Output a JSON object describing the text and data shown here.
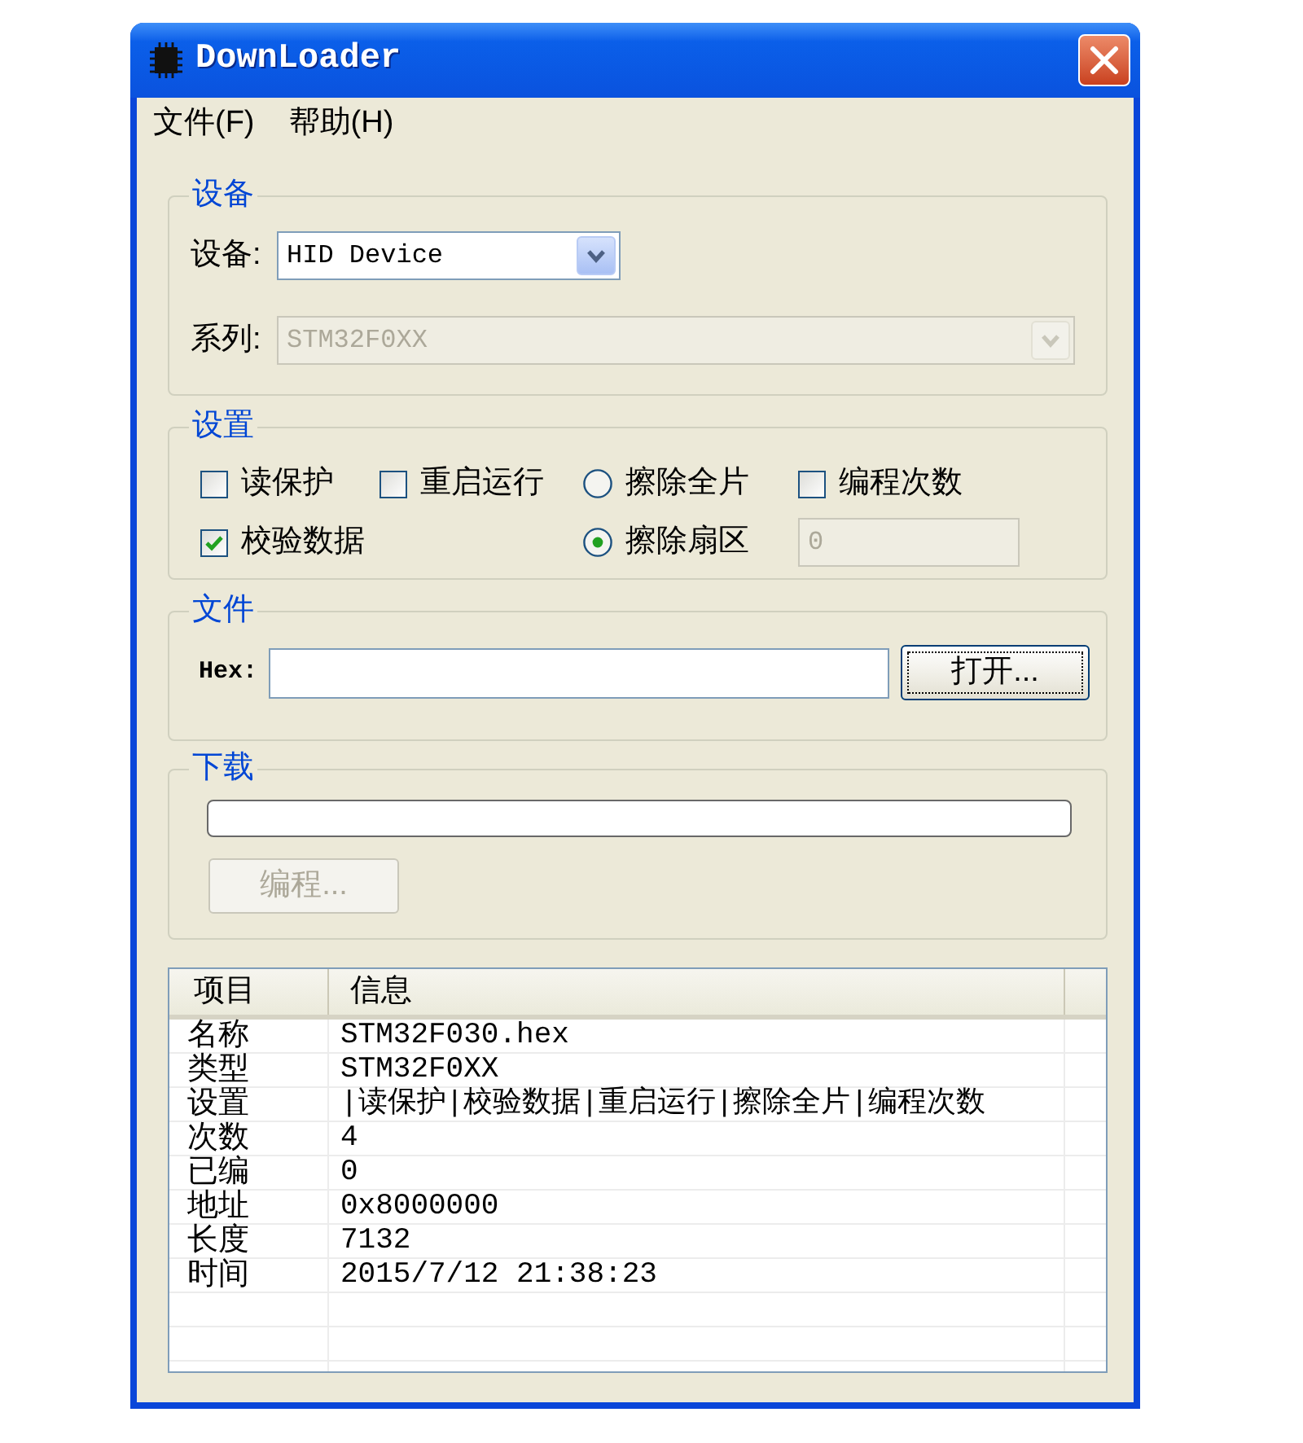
{
  "window": {
    "title": "DownLoader"
  },
  "menu": [
    {
      "label": "文件(F)"
    },
    {
      "label": "帮助(H)"
    }
  ],
  "device_group": {
    "title": "设备",
    "fields": [
      {
        "label": "设备:",
        "value": "HID Device",
        "disabled": false
      },
      {
        "label": "系列:",
        "value": "STM32F0XX",
        "disabled": true
      }
    ]
  },
  "settings_group": {
    "title": "设置",
    "columns": [
      [
        {
          "kind": "checkbox",
          "label": "读保护",
          "checked": false
        },
        {
          "kind": "checkbox",
          "label": "校验数据",
          "checked": true
        }
      ],
      [
        {
          "kind": "checkbox",
          "label": "重启运行",
          "checked": false
        }
      ],
      [
        {
          "kind": "radio",
          "label": "擦除全片",
          "selected": false
        },
        {
          "kind": "radio",
          "label": "擦除扇区",
          "selected": true
        }
      ],
      [
        {
          "kind": "checkbox",
          "label": "编程次数",
          "checked": false
        },
        {
          "kind": "field",
          "value": "0",
          "disabled": true
        }
      ]
    ]
  },
  "file_group": {
    "title": "文件",
    "label": "Hex:",
    "button": {
      "label": "打开...",
      "focused": true
    }
  },
  "download_group": {
    "title": "下载",
    "progress": {
      "level": 0
    },
    "button": {
      "label": "编程...",
      "disabled": true
    }
  },
  "info_table": {
    "columns": [
      "项目",
      "信息"
    ],
    "rows": [
      [
        "名称",
        "STM32F030.hex"
      ],
      [
        "类型",
        "STM32F0XX"
      ],
      [
        "设置",
        "|读保护|校验数据|重启运行|擦除全片|编程次数"
      ],
      [
        "次数",
        "4"
      ],
      [
        "已编",
        "0"
      ],
      [
        "地址",
        "0x8000000"
      ],
      [
        "长度",
        "7132"
      ],
      [
        "时间",
        "2015/7/12 21:38:23"
      ]
    ]
  }
}
